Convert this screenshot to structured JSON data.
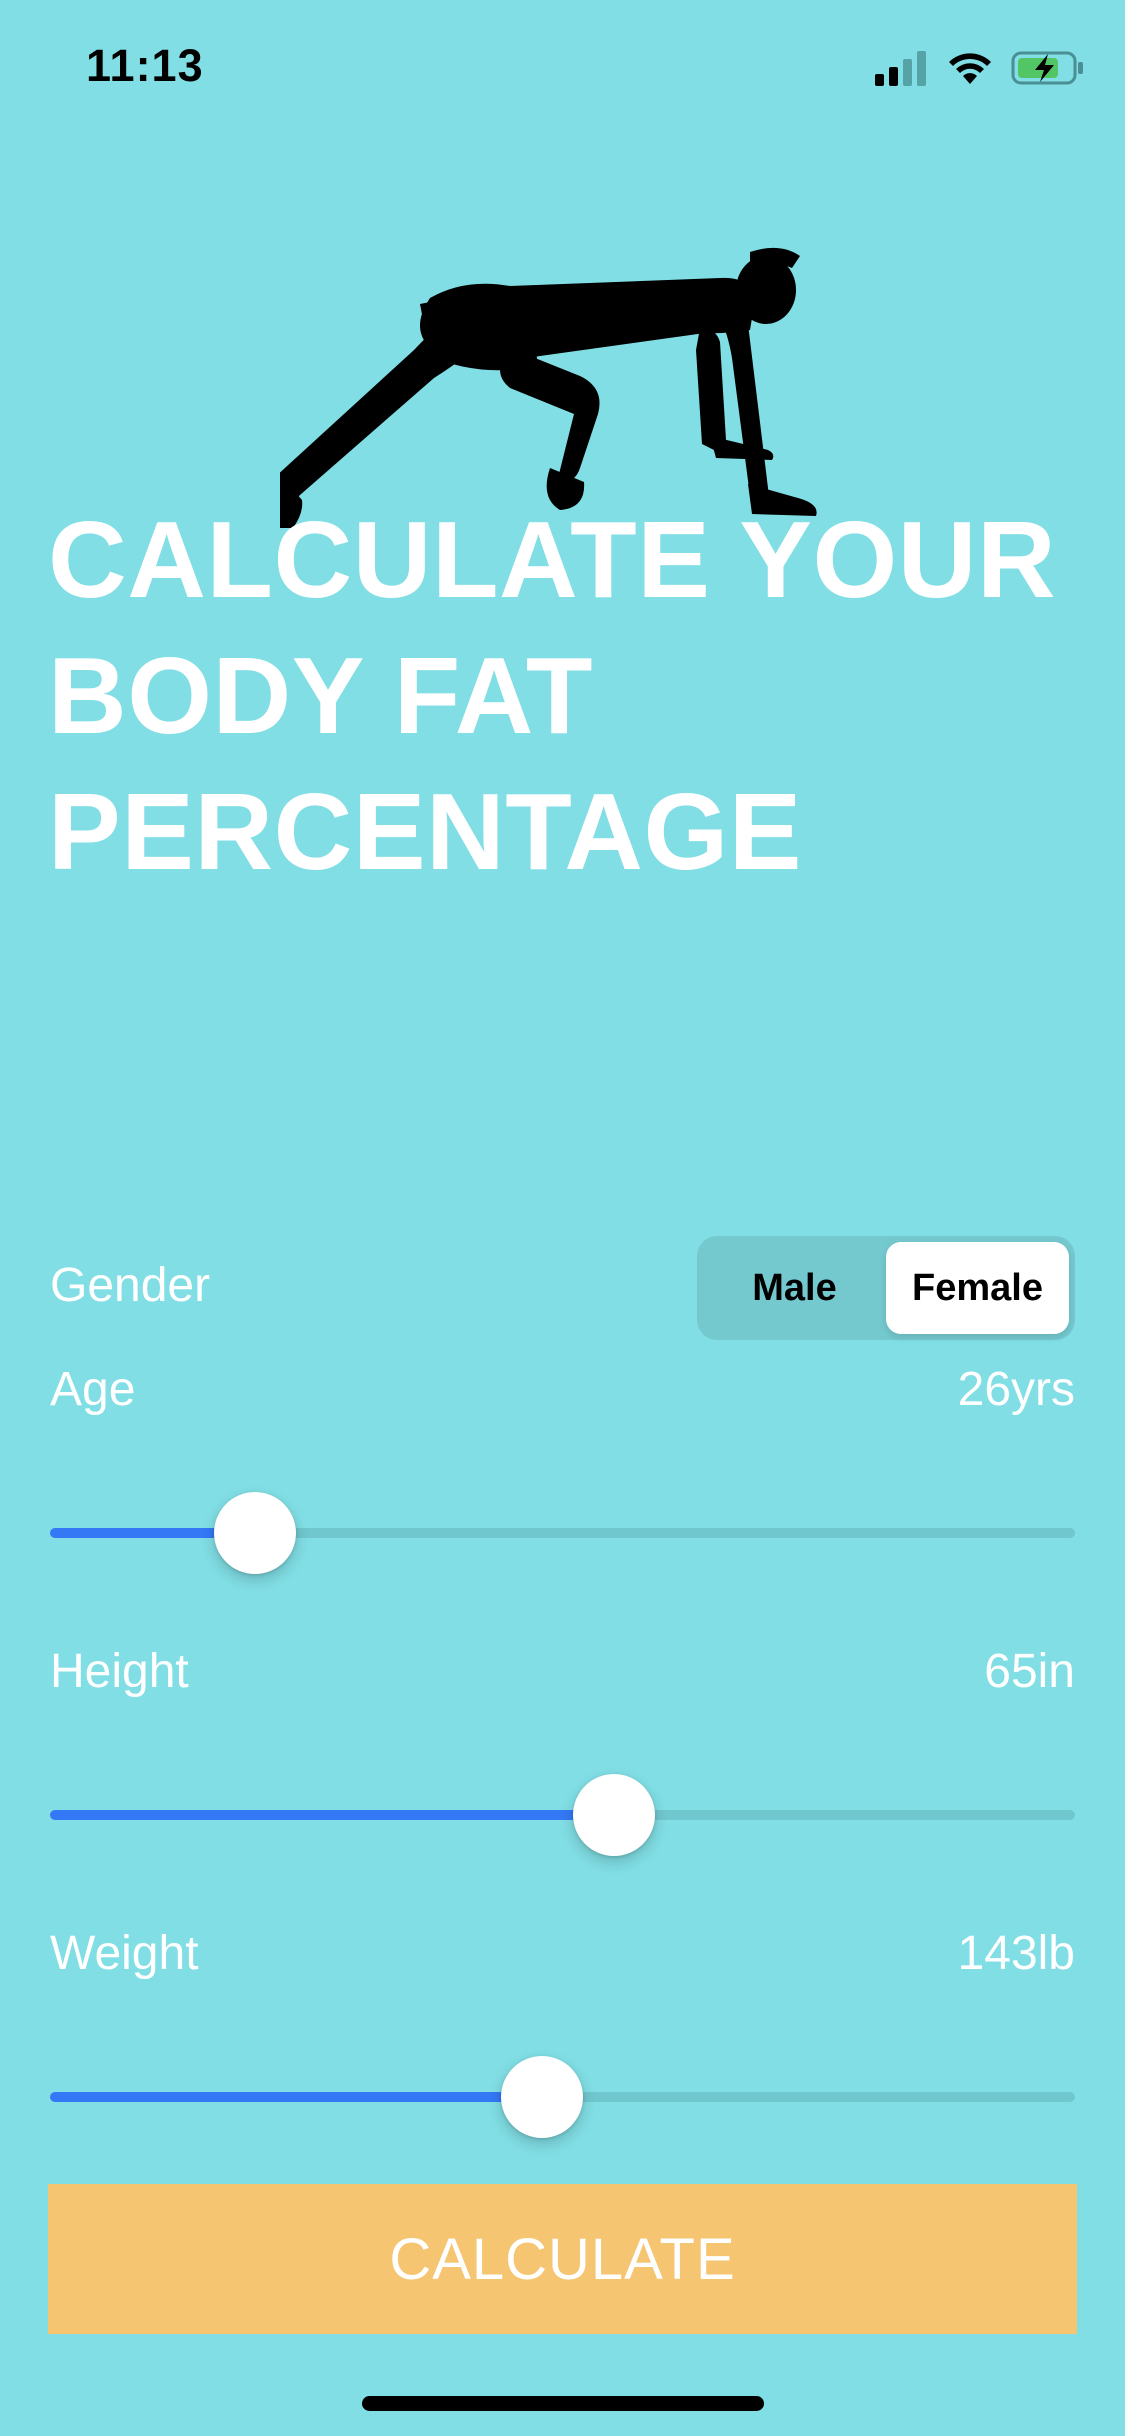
{
  "status_bar": {
    "time": "11:13",
    "icons": [
      "cellular-signal-icon",
      "wifi-icon",
      "battery-charging-icon"
    ]
  },
  "hero": {
    "image": "runner-silhouette-icon",
    "headline": [
      "CALCULATE YOUR",
      "BODY FAT",
      "PERCENTAGE"
    ]
  },
  "form": {
    "gender": {
      "label": "Gender",
      "options": [
        "Male",
        "Female"
      ],
      "selected": "Female"
    },
    "age": {
      "label": "Age",
      "value": "26yrs",
      "slider_fraction": 0.2
    },
    "height": {
      "label": "Height",
      "value": "65in",
      "slider_fraction": 0.55
    },
    "weight": {
      "label": "Weight",
      "value": "143lb",
      "slider_fraction": 0.48
    }
  },
  "calculate_button": {
    "label": "CALCULATE"
  },
  "colors": {
    "background": "#80DEE4",
    "slider_fill": "#3478F6",
    "slider_track": "#70C7CD",
    "button": "#F5C572",
    "segment_bg": "#74C9CF"
  }
}
